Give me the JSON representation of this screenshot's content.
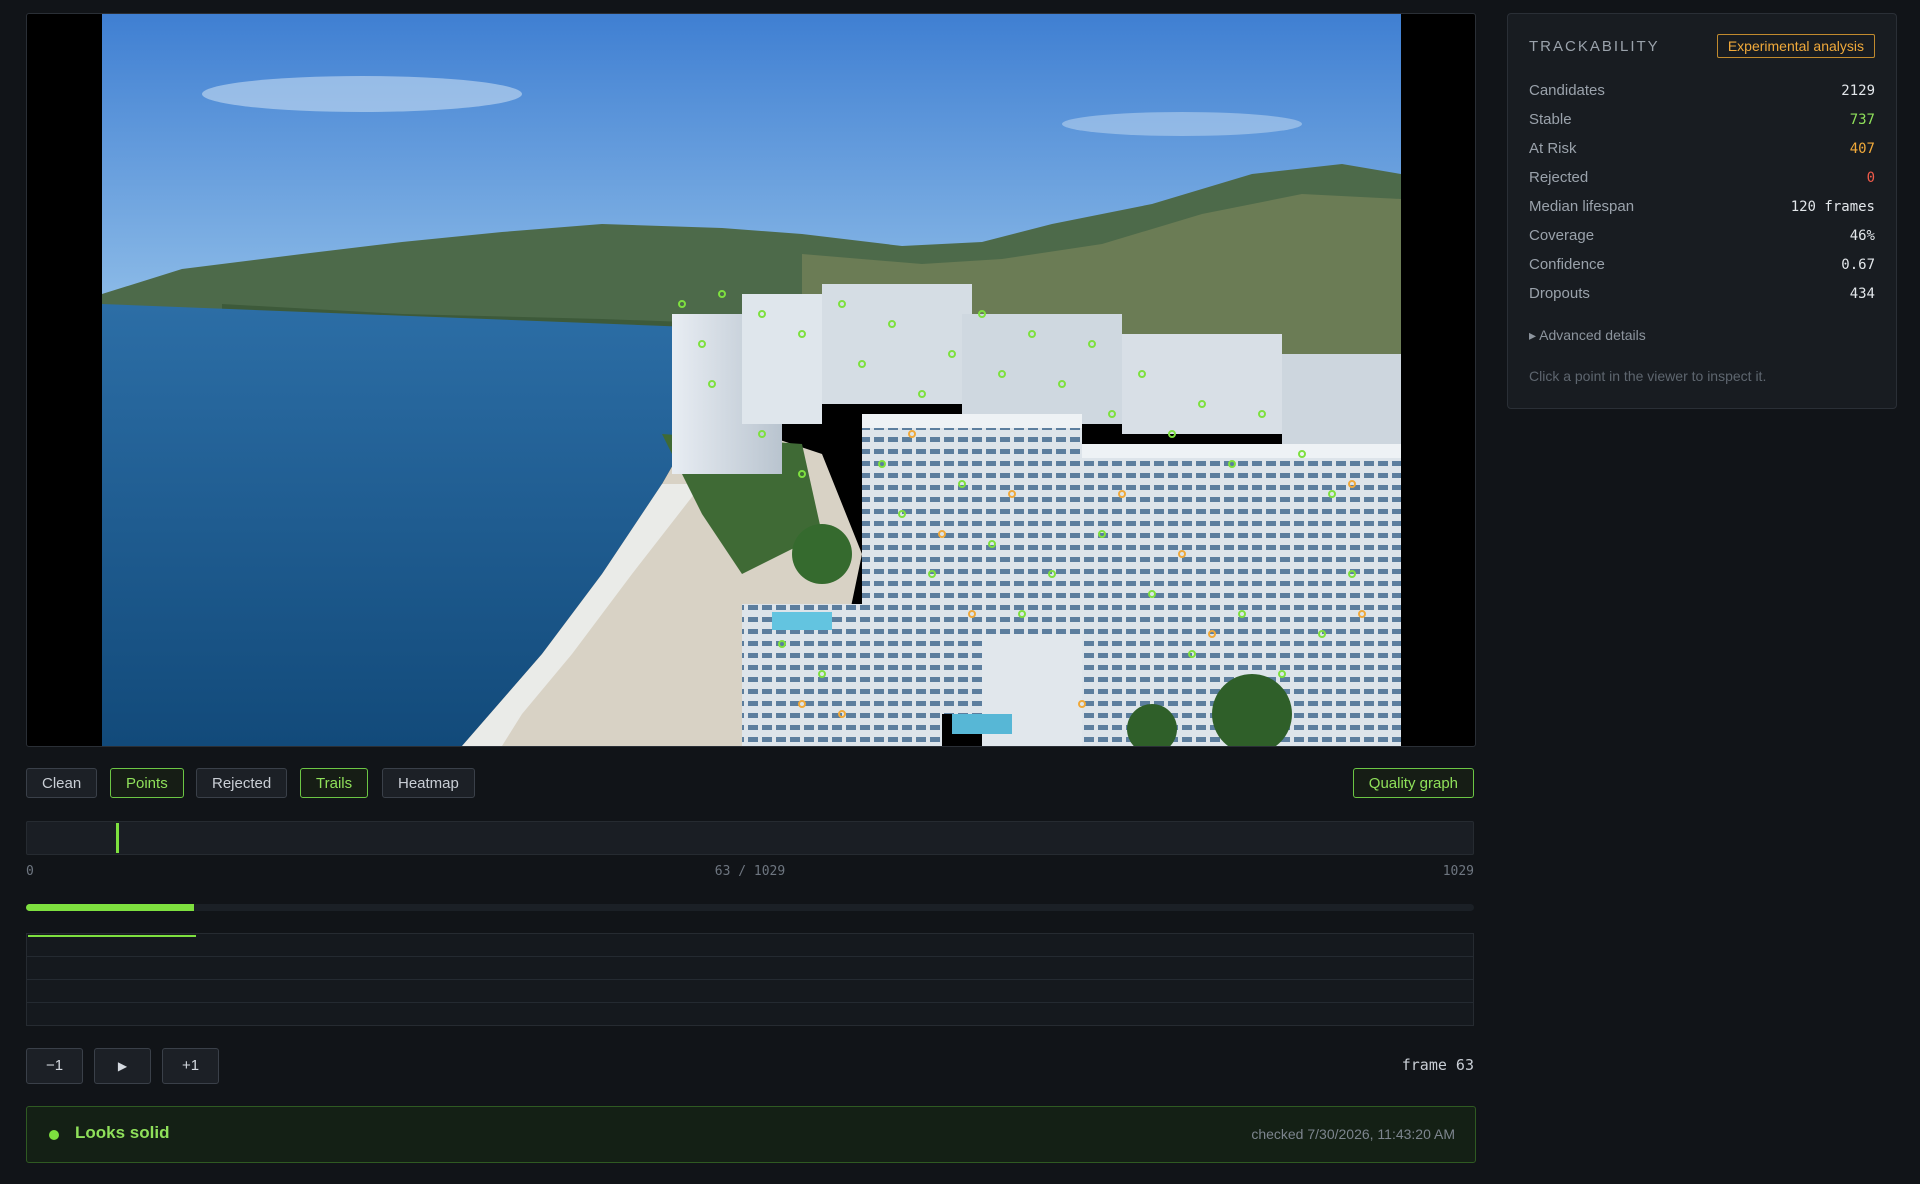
{
  "toolbar": {
    "clean": "Clean",
    "points": "Points",
    "rejected": "Rejected",
    "trails": "Trails",
    "heatmap": "Heatmap",
    "quality_graph": "Quality graph"
  },
  "timeline": {
    "start_label": "0",
    "position_label": "63 / 1029",
    "end_label": "1029",
    "current_frame": 63,
    "total_frames": 1029,
    "progress_fraction": 0.116
  },
  "controls": {
    "prev": "−1",
    "play": "▶",
    "next": "+1",
    "frame_label": "frame 63"
  },
  "status": {
    "text": "Looks solid",
    "checked": "checked 7/30/2026, 11:43:20 AM"
  },
  "panel": {
    "title": "TRACKABILITY",
    "badge": "Experimental analysis",
    "metrics": [
      {
        "label": "Candidates",
        "value": "2129"
      },
      {
        "label": "Stable",
        "value": "737"
      },
      {
        "label": "At Risk",
        "value": "407"
      },
      {
        "label": "Rejected",
        "value": "0"
      },
      {
        "label": "Median lifespan",
        "value": "120 frames"
      },
      {
        "label": "Coverage",
        "value": "46%"
      },
      {
        "label": "Confidence",
        "value": "0.67"
      },
      {
        "label": "Dropouts",
        "value": "434"
      }
    ],
    "advanced": "▸ Advanced details",
    "hint": "Click a point in the viewer to inspect it."
  },
  "colors": {
    "accent": "#7ee03f",
    "stable": "#8fe05a",
    "at_risk": "#f0a93a",
    "rejected": "#f05a4a"
  },
  "icons": {
    "play": "play-icon",
    "status": "status-dot-icon"
  }
}
